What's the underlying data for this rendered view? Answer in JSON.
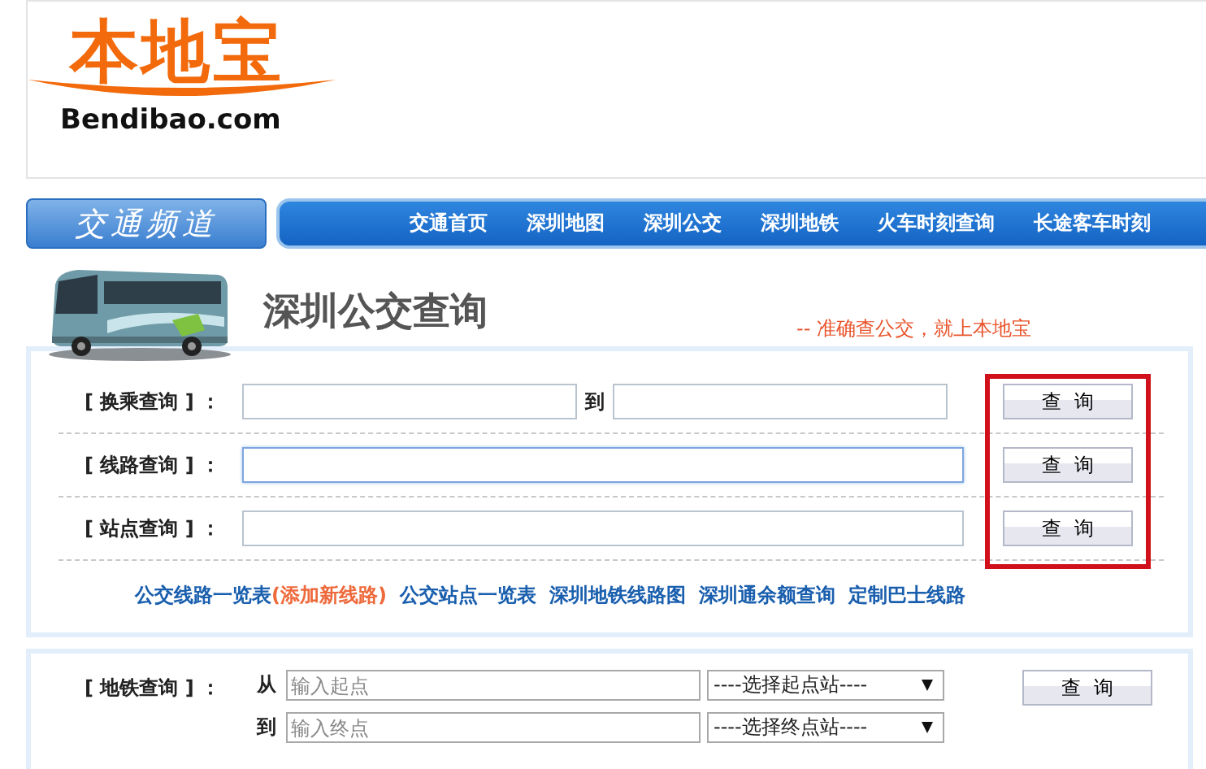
{
  "logo": {
    "name": "本地宝",
    "domain": "Bendibao.com"
  },
  "nav": {
    "channel": "交通频道",
    "items": [
      "交通首页",
      "深圳地图",
      "深圳公交",
      "深圳地铁",
      "火车时刻查询",
      "长途客车时刻"
    ]
  },
  "heading": {
    "title": "深圳公交查询",
    "slogan": "-- 准确查公交，就上本地宝"
  },
  "bus_search": {
    "highlight_buttons": true,
    "rows": [
      {
        "kind": "pair",
        "label": "[ 换乘查询 ] ：",
        "fields": [
          {
            "focused": false
          },
          {
            "focused": false
          }
        ],
        "between": "到",
        "button": "查  询"
      },
      {
        "kind": "single",
        "label": "[ 线路查询 ] ：",
        "fields": [
          {
            "focused": true
          }
        ],
        "button": "查  询"
      },
      {
        "kind": "single",
        "label": "[ 站点查询 ] ：",
        "fields": [
          {
            "focused": false
          }
        ],
        "button": "查  询"
      }
    ],
    "links": [
      {
        "text": "公交线路一览表",
        "kind": "main"
      },
      {
        "text": "(添加新线路)",
        "kind": "accent"
      },
      {
        "text": "公交站点一览表",
        "kind": "main"
      },
      {
        "text": "深圳地铁线路图",
        "kind": "main"
      },
      {
        "text": "深圳通余额查询",
        "kind": "main"
      },
      {
        "text": "定制巴士线路",
        "kind": "main"
      }
    ]
  },
  "subway_search": {
    "label": "[ 地铁查询 ] ：",
    "rows": [
      {
        "prefix": "从",
        "placeholder": "输入起点",
        "select": "----选择起点站----"
      },
      {
        "prefix": "到",
        "placeholder": "输入终点",
        "select": "----选择终点站----"
      }
    ],
    "button": "查  询"
  }
}
